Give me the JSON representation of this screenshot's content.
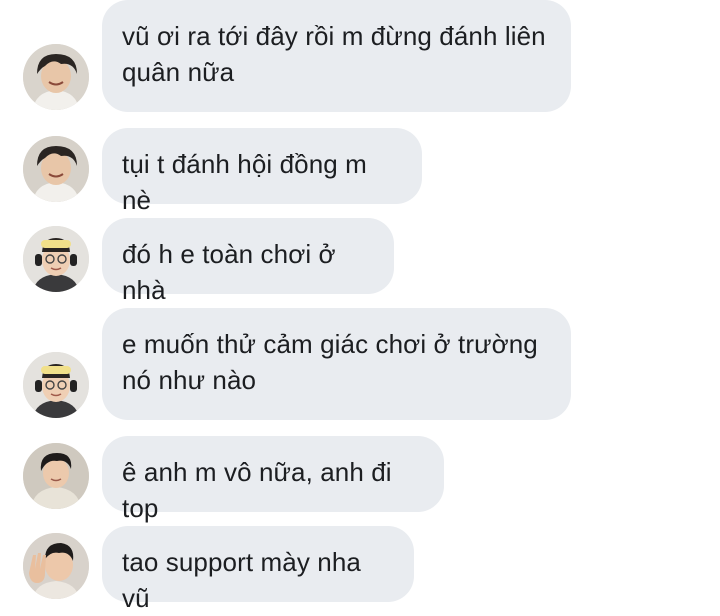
{
  "messages": [
    {
      "text": "vũ ơi ra tới đây rồi m đừng đánh liên quân nữa",
      "avatar": "avatar-dark-hair-smiling"
    },
    {
      "text": "tụi t đánh hội đồng m nè",
      "avatar": "avatar-dark-hair-smiling"
    },
    {
      "text": "đó h e toàn chơi ở nhà",
      "avatar": "avatar-yellow-headphones-glasses"
    },
    {
      "text": "e muốn thử cảm giác chơi ở trường nó như nào",
      "avatar": "avatar-yellow-headphones-glasses"
    },
    {
      "text": "ê anh m vô nữa, anh đi top",
      "avatar": "avatar-dark-hair-jacket"
    },
    {
      "text": "tao support mày nha vũ",
      "avatar": "avatar-waving-hand"
    }
  ],
  "colors": {
    "bubble": "#e9ecf0",
    "text": "#1c1e21",
    "background": "#ffffff"
  }
}
